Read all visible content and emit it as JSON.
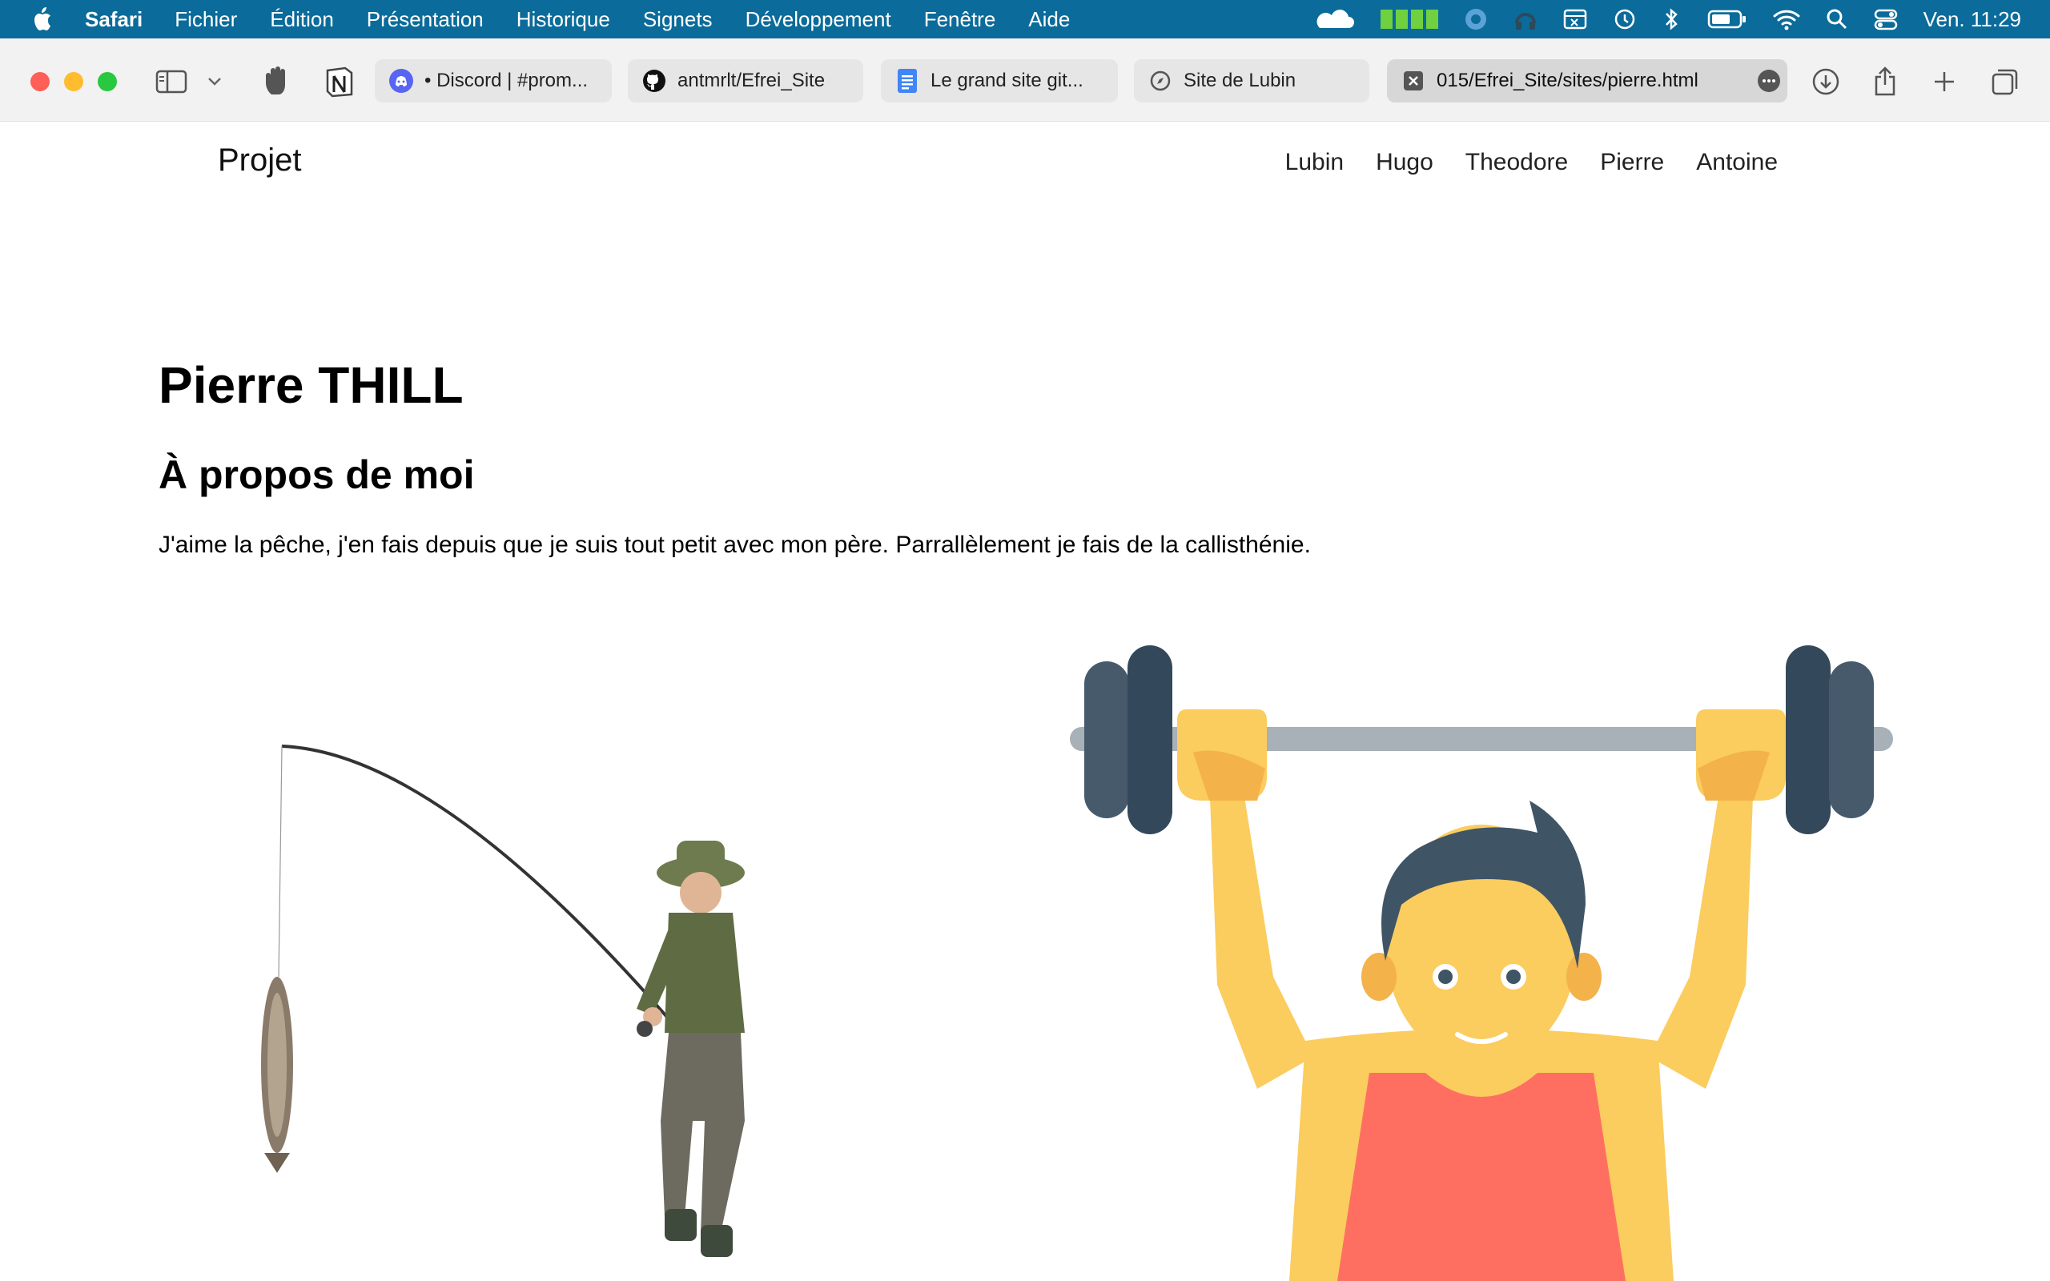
{
  "menubar": {
    "app_name": "Safari",
    "menus": [
      "Fichier",
      "Édition",
      "Présentation",
      "Historique",
      "Signets",
      "Développement",
      "Fenêtre",
      "Aide"
    ],
    "clock": "Ven. 11:29"
  },
  "toolbar": {
    "tabs": [
      {
        "label": "• Discord | #prom...",
        "icon": "discord-icon"
      },
      {
        "label": "antmrlt/Efrei_Site",
        "icon": "github-icon"
      },
      {
        "label": "Le grand site git...",
        "icon": "docs-icon"
      },
      {
        "label": "Site de Lubin",
        "icon": "compass-icon"
      },
      {
        "label": "015/Efrei_Site/sites/pierre.html",
        "icon": "page-icon"
      }
    ]
  },
  "site": {
    "brand": "Projet",
    "nav": [
      "Lubin",
      "Hugo",
      "Theodore",
      "Pierre",
      "Antoine"
    ]
  },
  "content": {
    "title": "Pierre THILL",
    "section_heading": "À propos de moi",
    "paragraph": "J'aime la pêche, j'en fais depuis que je suis tout petit avec mon père. Parrallèlement je fais de la callisthénie."
  },
  "colors": {
    "menubar_bg": "#0b6b9a",
    "discord": "#5865f2",
    "docs": "#4285f4",
    "skin": "#fbcc5e",
    "hair": "#3f5566",
    "tank": "#ff6f61",
    "plate": "#3a4a5c",
    "bar": "#a8b0b8"
  }
}
